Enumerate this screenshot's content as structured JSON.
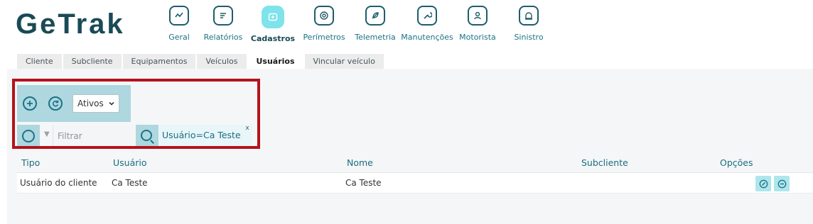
{
  "brand": {
    "logo_text": "GeTrak"
  },
  "nav": {
    "items": [
      {
        "label": "Geral",
        "icon": "monitor-chart-icon"
      },
      {
        "label": "Relatórios",
        "icon": "report-icon"
      },
      {
        "label": "Cadastros",
        "icon": "folder-add-icon",
        "active": true
      },
      {
        "label": "Perímetros",
        "icon": "target-icon"
      },
      {
        "label": "Telemetria",
        "icon": "leaf-gauge-icon"
      },
      {
        "label": "Manutenções",
        "icon": "wrench-icon"
      },
      {
        "label": "Motorista",
        "icon": "driver-icon"
      },
      {
        "label": "Sinistro",
        "icon": "siren-icon"
      }
    ]
  },
  "tabs": [
    {
      "label": "Cliente"
    },
    {
      "label": "Subcliente"
    },
    {
      "label": "Equipamentos"
    },
    {
      "label": "Veículos"
    },
    {
      "label": "Usuários",
      "active": true
    },
    {
      "label": "Vincular veículo"
    }
  ],
  "toolbar": {
    "status_select": "Ativos"
  },
  "filter": {
    "placeholder": "Filtrar",
    "chip_text": "Usuário=Ca Teste",
    "chip_close": "x"
  },
  "table": {
    "columns": [
      "Tipo",
      "Usuário",
      "Nome",
      "Subcliente",
      "Opções"
    ],
    "rows": [
      {
        "tipo": "Usuário do cliente",
        "usuario": "Ca Teste",
        "nome": "Ca Teste",
        "subcliente": ""
      }
    ]
  },
  "colors": {
    "accent": "#1b7386",
    "brand_dark": "#1a4a56",
    "toolbar_bg": "#aed7df",
    "active_nav": "#7ee3ea",
    "highlight": "#b5121b"
  }
}
